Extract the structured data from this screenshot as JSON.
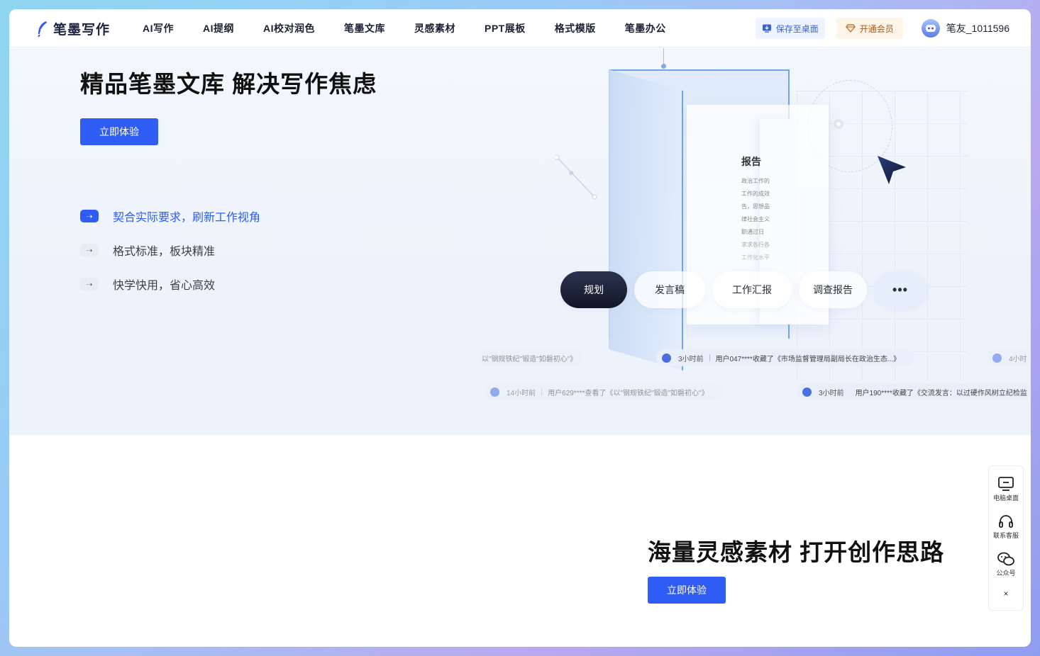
{
  "brand": {
    "name": "笔墨写作"
  },
  "nav": {
    "items": [
      "AI写作",
      "AI提纲",
      "AI校对润色",
      "笔墨文库",
      "灵感素材",
      "PPT展板",
      "格式模版",
      "笔墨办公"
    ]
  },
  "header_actions": {
    "save_desktop": "保存至桌面",
    "vip": "开通会员",
    "username": "笔友_1011596"
  },
  "hero1": {
    "title": "精品笔墨文库 解决写作焦虑",
    "cta": "立即体验",
    "features": [
      {
        "text": "契合实际要求，刷新工作视角",
        "active": true
      },
      {
        "text": "格式标准，板块精准",
        "active": false
      },
      {
        "text": "快学快用，省心高效",
        "active": false
      }
    ]
  },
  "illustration": {
    "doc_title": "报告",
    "doc_lines": [
      "政治工作的",
      "工作的成效",
      "告，思想品",
      "律社会主义",
      "职通过日",
      "求求各行各",
      "工作化水平"
    ]
  },
  "categories": [
    {
      "label": "规划",
      "active": true
    },
    {
      "label": "发言稿",
      "active": false
    },
    {
      "label": "工作汇报",
      "active": false
    },
    {
      "label": "调查报告",
      "active": false
    },
    {
      "label": "•••",
      "active": false
    }
  ],
  "ticker": [
    {
      "time": "",
      "text": "以\"钢规铁纪\"锻造\"如磐初心\"》"
    },
    {
      "time": "3小时前",
      "text": "用户047****收藏了《市场监督管理局副局长在政治生态...》"
    },
    {
      "time": "4小时",
      "text": ""
    },
    {
      "time": "14小时前",
      "text": "用户629****查看了《以\"钢规铁纪\"锻造\"如磐初心\"》"
    },
    {
      "time": "3小时前",
      "text": "用户190****收藏了《交流发言：以过硬作风树立纪检监"
    }
  ],
  "hero2": {
    "title": "海量灵感素材 打开创作思路",
    "cta": "立即体验"
  },
  "sidebar": {
    "items": [
      "电脑桌面",
      "联系客服",
      "公众号"
    ],
    "close": "×"
  },
  "colors": {
    "primary": "#2e5cf5",
    "dark_pill": "#1a2035",
    "vip_text": "#a55a1b"
  }
}
